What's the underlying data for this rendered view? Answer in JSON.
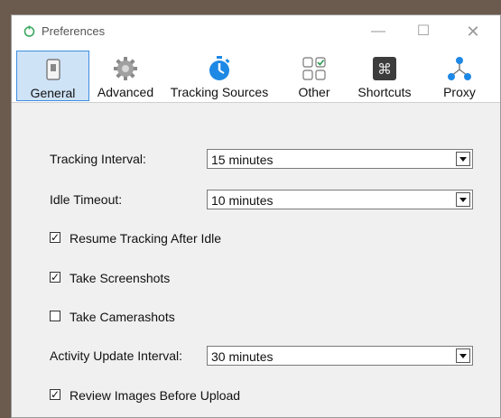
{
  "window": {
    "title": "Preferences",
    "controls": {
      "minimize": "—",
      "maximize": "☐",
      "close": "✕"
    }
  },
  "toolbar": {
    "tabs": [
      {
        "label": "General",
        "icon": "switch-icon",
        "active": true
      },
      {
        "label": "Advanced",
        "icon": "gear-icon",
        "active": false
      },
      {
        "label": "Tracking Sources",
        "icon": "stopwatch-icon",
        "active": false
      },
      {
        "label": "Other",
        "icon": "grid-check-icon",
        "active": false
      },
      {
        "label": "Shortcuts",
        "icon": "command-key-icon",
        "active": false
      },
      {
        "label": "Proxy",
        "icon": "network-nodes-icon",
        "active": false
      }
    ]
  },
  "general": {
    "tracking_interval": {
      "label": "Tracking Interval:",
      "value": "15 minutes"
    },
    "idle_timeout": {
      "label": "Idle Timeout:",
      "value": "10 minutes"
    },
    "resume_tracking": {
      "label": "Resume Tracking After Idle",
      "checked": true
    },
    "take_screenshots": {
      "label": "Take Screenshots",
      "checked": true
    },
    "take_camerashots": {
      "label": "Take Camerashots",
      "checked": false
    },
    "activity_update_interval": {
      "label": "Activity Update Interval:",
      "value": "30 minutes"
    },
    "review_images": {
      "label": "Review Images Before Upload",
      "checked": true
    }
  },
  "colors": {
    "active_tab_bg": "#cfe3f7",
    "active_tab_border": "#3d8ee0",
    "accent_blue": "#1e88e5",
    "app_icon_green": "#3aa860"
  }
}
